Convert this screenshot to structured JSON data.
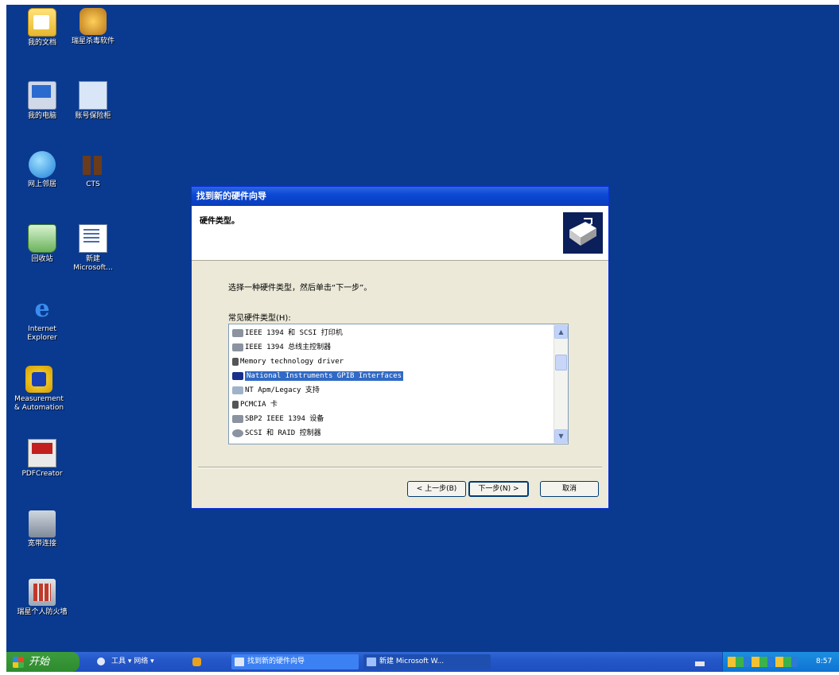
{
  "desktop": {
    "icons": [
      {
        "label": "我的文档",
        "icon": "my-documents-icon"
      },
      {
        "label": "瑞星杀毒软件",
        "icon": "rising-antivirus-icon"
      },
      {
        "label": "我的电脑",
        "icon": "my-computer-icon"
      },
      {
        "label": "账号保险柜",
        "icon": "account-safe-icon"
      },
      {
        "label": "网上邻居",
        "icon": "network-places-icon"
      },
      {
        "label": "CTS",
        "icon": "cts-icon"
      },
      {
        "label": "回收站",
        "icon": "recycle-bin-icon"
      },
      {
        "label": "新建\nMicrosoft...",
        "icon": "word-document-icon"
      },
      {
        "label": "Internet\nExplorer",
        "icon": "internet-explorer-icon"
      },
      {
        "label": "Measurement\n& Automation",
        "icon": "ni-max-icon"
      },
      {
        "label": "PDFCreator",
        "icon": "pdfcreator-icon"
      },
      {
        "label": "宽带连接",
        "icon": "broadband-connection-icon"
      },
      {
        "label": "瑞星个人防火墙",
        "icon": "rising-firewall-icon"
      }
    ]
  },
  "wizard": {
    "title": "找到新的硬件向导",
    "header_title": "硬件类型。",
    "instruction": "选择一种硬件类型，然后单击“下一步”。",
    "list_label": "常见硬件类型(H):",
    "items": [
      {
        "label": "IEEE 1394 和 SCSI 打印机",
        "icon": "printer-device-icon",
        "selected": false
      },
      {
        "label": "IEEE 1394 总线主控制器",
        "icon": "bus-controller-icon",
        "selected": false
      },
      {
        "label": "Memory technology driver",
        "icon": "memory-card-icon",
        "selected": false
      },
      {
        "label": "National Instruments GPIB Interfaces",
        "icon": "ni-gpib-icon",
        "selected": true
      },
      {
        "label": "NT Apm/Legacy 支持",
        "icon": "legacy-support-icon",
        "selected": false
      },
      {
        "label": "PCMCIA 卡",
        "icon": "pcmcia-card-icon",
        "selected": false
      },
      {
        "label": "SBP2 IEEE 1394 设备",
        "icon": "sbp2-device-icon",
        "selected": false
      },
      {
        "label": "SCSI 和 RAID 控制器",
        "icon": "scsi-controller-icon",
        "selected": false
      }
    ],
    "buttons": {
      "back": "< 上一步(B)",
      "next": "下一步(N) >",
      "cancel": "取消"
    }
  },
  "taskbar": {
    "start_label": "开始",
    "toolbar_text": "工具 ▾ 网络 ▾",
    "tasks": [
      {
        "label": "找到新的硬件向导"
      },
      {
        "label": "新建 Microsoft W..."
      }
    ],
    "clock": "8:57"
  }
}
